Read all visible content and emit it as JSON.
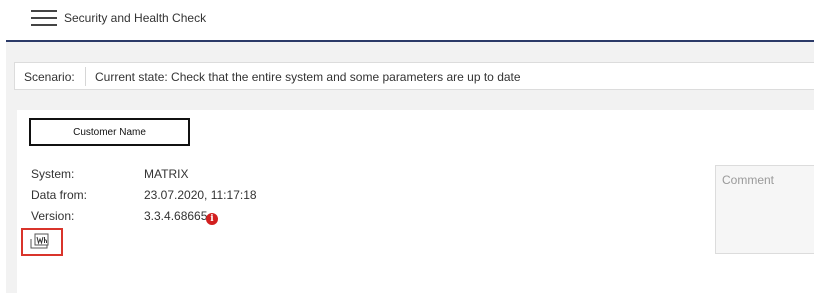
{
  "header": {
    "title": "Security and Health Check"
  },
  "scenario": {
    "label": "Scenario:",
    "value": "Current state: Check that the entire system and some parameters are up to date"
  },
  "report": {
    "customer_name": "Customer Name",
    "rows": [
      {
        "label": "System:",
        "value": "MATRIX"
      },
      {
        "label": "Data from:",
        "value": "23.07.2020, 11:17:18"
      },
      {
        "label": "Version:",
        "value": "3.3.4.68665"
      }
    ],
    "info_icon_glyph": "i",
    "word_icon": "word-export-icon"
  },
  "comment": {
    "placeholder": "Comment"
  },
  "colors": {
    "header_line": "#2b3a68",
    "info_icon": "#d21f1f",
    "highlight": "#d9342b",
    "background": "#f2f2f2"
  }
}
